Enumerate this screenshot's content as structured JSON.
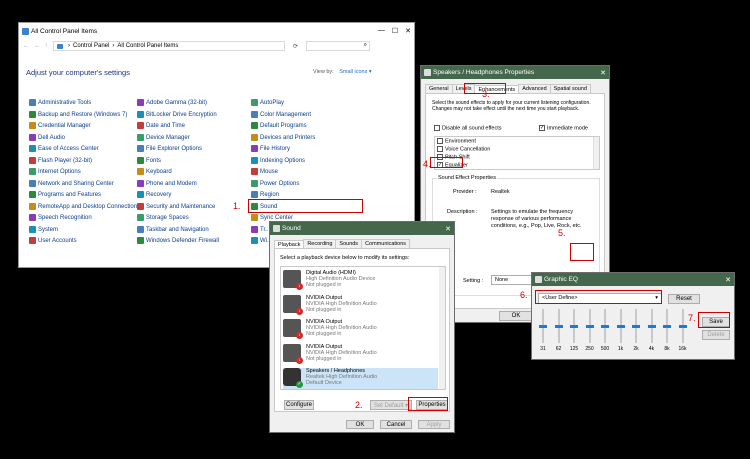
{
  "control_panel": {
    "title": "All Control Panel Items",
    "breadcrumb_1": "Control Panel",
    "breadcrumb_2": "All Control Panel Items",
    "heading": "Adjust your computer's settings",
    "view_by_label": "View by:",
    "view_by_value": "Small icons ▾",
    "col1": [
      "Administrative Tools",
      "Backup and Restore (Windows 7)",
      "Credential Manager",
      "Dell Audio",
      "Ease of Access Center",
      "Flash Player (32-bit)",
      "Internet Options",
      "Network and Sharing Center",
      "Programs and Features",
      "RemoteApp and Desktop Connections",
      "Speech Recognition",
      "System",
      "User Accounts"
    ],
    "col2": [
      "Adobe Gamma (32-bit)",
      "BitLocker Drive Encryption",
      "Date and Time",
      "Device Manager",
      "File Explorer Options",
      "Fonts",
      "Keyboard",
      "Phone and Modem",
      "Recovery",
      "Security and Maintenance",
      "Storage Spaces",
      "Taskbar and Navigation",
      "Windows Defender Firewall"
    ],
    "col3": [
      "AutoPlay",
      "Color Management",
      "Default Programs",
      "Devices and Printers",
      "File History",
      "Indexing Options",
      "Mouse",
      "Power Options",
      "Region",
      "Sound",
      "Sync Center",
      "Tr...",
      "Wi..."
    ]
  },
  "sound": {
    "title": "Sound",
    "tabs": [
      "Playback",
      "Recording",
      "Sounds",
      "Communications"
    ],
    "instruction": "Select a playback device below to modify its settings:",
    "devices": [
      {
        "name": "Digital Audio (HDMI)",
        "line2": "High Definition Audio Device",
        "line3": "Not plugged in"
      },
      {
        "name": "NVIDIA Output",
        "line2": "NVIDIA High Definition Audio",
        "line3": "Not plugged in"
      },
      {
        "name": "NVIDIA Output",
        "line2": "NVIDIA High Definition Audio",
        "line3": "Not plugged in"
      },
      {
        "name": "NVIDIA Output",
        "line2": "NVIDIA High Definition Audio",
        "line3": "Not plugged in"
      },
      {
        "name": "Speakers / Headphones",
        "line2": "Realtek High Definition Audio",
        "line3": "Default Device"
      }
    ],
    "configure": "Configure",
    "set_default": "Set Default ▾",
    "properties": "Properties",
    "ok": "OK",
    "cancel": "Cancel",
    "apply": "Apply"
  },
  "props": {
    "title": "Speakers / Headphones Properties",
    "tabs": [
      "General",
      "Levels",
      "Enhancements",
      "Advanced",
      "Spatial sound"
    ],
    "desc": "Select the sound effects to apply for your current listening configuration. Changes may not take effect until the next time you start playback.",
    "disable_all": "Disable all sound effects",
    "immediate": "Immediate mode",
    "effects": [
      "Environment",
      "Voice Cancellation",
      "Pitch Shift",
      "Equalizer"
    ],
    "group_title": "Sound Effect Properties",
    "provider_label": "Provider :",
    "provider_value": "Realtek",
    "description_label": "Description :",
    "description_value": "Settings to emulate the frequency response of various performance conditions, e.g., Pop, Live, Rock, etc.",
    "setting_label": "Setting :",
    "setting_value": "None",
    "more_btn": "...",
    "ok": "OK"
  },
  "eq": {
    "title": "Graphic EQ",
    "preset": "<User Define>",
    "reset": "Reset",
    "save": "Save",
    "delete": "Delete",
    "bands": [
      "31",
      "62",
      "125",
      "250",
      "500",
      "1k",
      "2k",
      "4k",
      "8k",
      "16k"
    ],
    "levels": [
      0.5,
      0.5,
      0.5,
      0.5,
      0.5,
      0.5,
      0.5,
      0.5,
      0.5,
      0.5
    ]
  },
  "steps": [
    "1.",
    "2.",
    "3.",
    "4.",
    "5.",
    "6.",
    "7."
  ]
}
